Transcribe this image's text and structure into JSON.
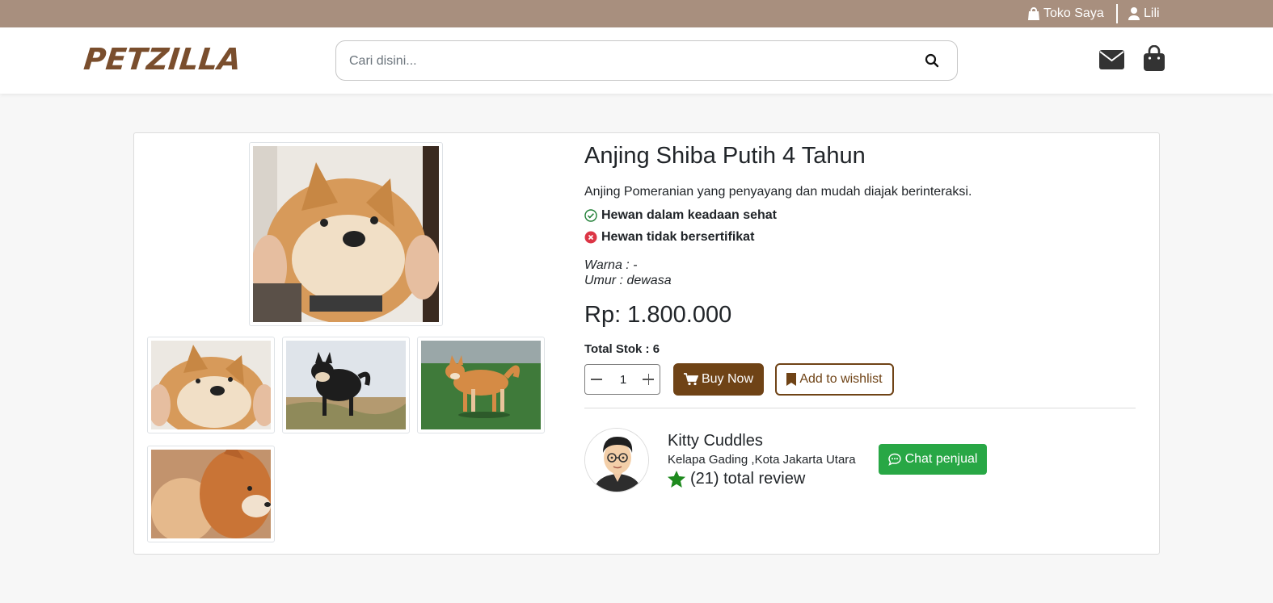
{
  "topbar": {
    "shop_label": "Toko Saya",
    "user_label": "Lili"
  },
  "header": {
    "logo": "PETZILLA",
    "search_placeholder": "Cari disini..."
  },
  "product": {
    "title": "Anjing Shiba Putih 4 Tahun",
    "description": "Anjing Pomeranian yang penyayang dan mudah diajak berinteraksi.",
    "health": "Hewan dalam keadaan sehat",
    "certificate": "Hewan tidak bersertifikat",
    "color": "Warna : -",
    "age": "Umur : dewasa",
    "price": "Rp: 1.800.000",
    "stock": "Total Stok : 6",
    "quantity": "1",
    "buy_label": "Buy Now",
    "wishlist_label": "Add to wishlist",
    "images": [
      "shiba-face-closeup",
      "black-shiba-outdoor",
      "shiba-standing-grass",
      "shiba-profile"
    ]
  },
  "seller": {
    "name": "Kitty Cuddles",
    "location": "Kelapa Gading ,Kota Jakarta Utara",
    "review": "(21) total review",
    "chat_label": "Chat penjual"
  },
  "colors": {
    "topbar": "#a88f7e",
    "brand_brown": "#6f4316",
    "chat_green": "#28a745",
    "star_green": "#1e8a1e",
    "cross_red": "#dc3545"
  },
  "icons": [
    "bag-icon",
    "user-icon",
    "search-icon",
    "mail-icon",
    "shopping-bag-icon",
    "check-circle-icon",
    "x-circle-icon",
    "cart-icon",
    "bookmark-icon",
    "star-icon",
    "chat-icon"
  ]
}
